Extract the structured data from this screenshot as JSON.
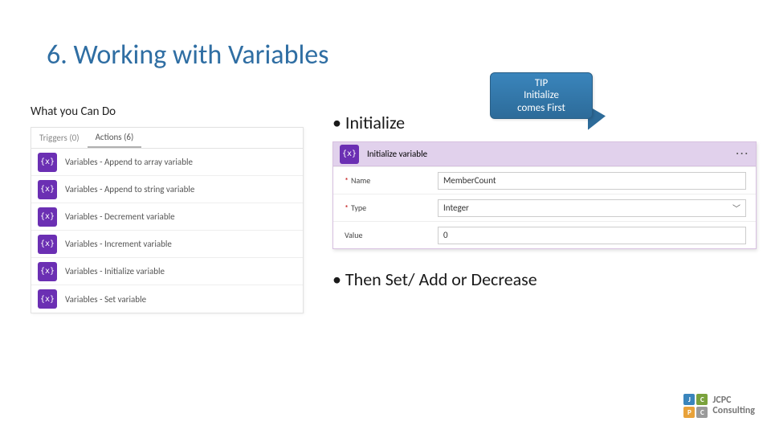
{
  "title": "6. Working with Variables",
  "subtitle": "What you Can Do",
  "bullets": {
    "b1": "• Initialize",
    "b2": "• Then Set/ Add or Decrease"
  },
  "tip": {
    "line1": "TIP",
    "line2": "Initialize",
    "line3": "comes First"
  },
  "actions_panel": {
    "tab_triggers": "Triggers (0)",
    "tab_actions": "Actions (6)",
    "items": [
      "Variables - Append to array variable",
      "Variables - Append to string variable",
      "Variables - Decrement variable",
      "Variables - Increment variable",
      "Variables - Initialize variable",
      "Variables - Set variable"
    ]
  },
  "init_card": {
    "header": "Initialize variable",
    "rows": {
      "name_label": "Name",
      "name_value": "MemberCount",
      "type_label": "Type",
      "type_value": "Integer",
      "value_label": "Value",
      "value_value": "0"
    }
  },
  "logo": {
    "j": "J",
    "c1": "C",
    "p": "P",
    "c2": "C",
    "line1": "JCPC",
    "line2": "Consulting"
  },
  "var_icon_text": "{x}"
}
